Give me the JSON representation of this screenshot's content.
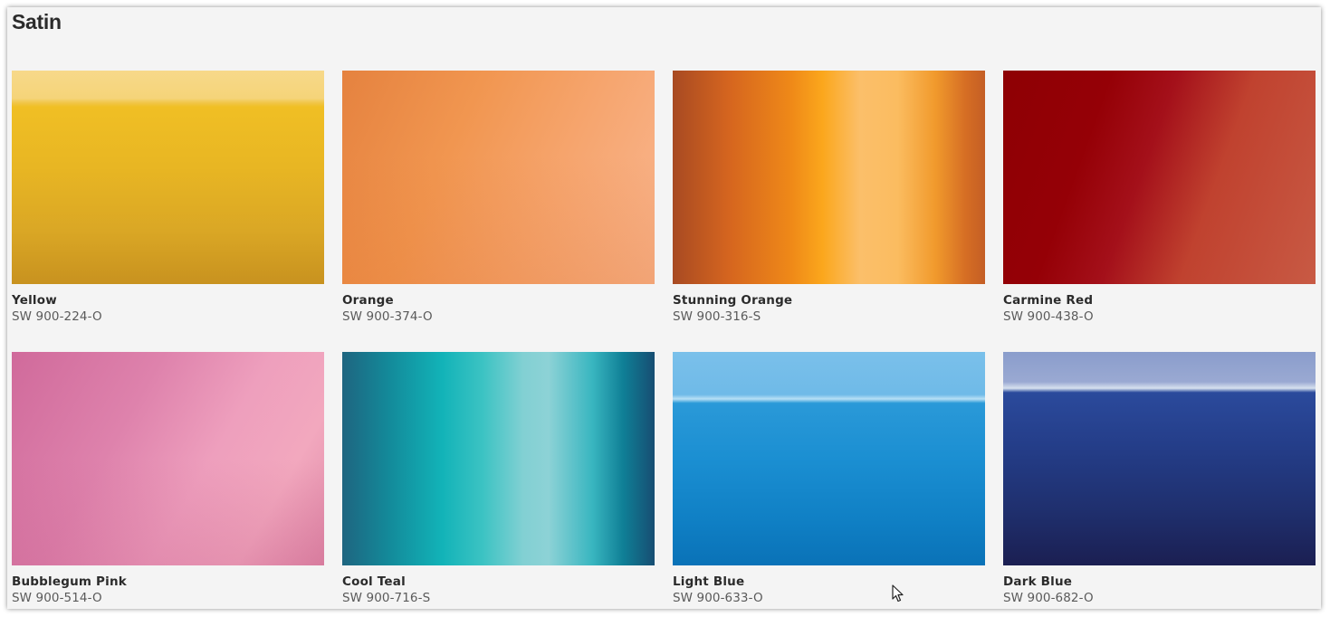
{
  "section": {
    "title": "Satin"
  },
  "colors": [
    {
      "name": "Yellow",
      "code": "SW 900-224-O",
      "swatch": "#f0bf24"
    },
    {
      "name": "Orange",
      "code": "SW 900-374-O",
      "swatch": "#f19650"
    },
    {
      "name": "Stunning Orange",
      "code": "SW 900-316-S",
      "swatch": "#fba71c"
    },
    {
      "name": "Carmine Red",
      "code": "SW 900-438-O",
      "swatch": "#950006"
    },
    {
      "name": "Bubblegum Pink",
      "code": "SW 900-514-O",
      "swatch": "#de82ac"
    },
    {
      "name": "Cool Teal",
      "code": "SW 900-716-S",
      "swatch": "#12b3b8"
    },
    {
      "name": "Light Blue",
      "code": "SW 900-633-O",
      "swatch": "#1b8fd2"
    },
    {
      "name": "Dark Blue",
      "code": "SW 900-682-O",
      "swatch": "#243d88"
    }
  ]
}
